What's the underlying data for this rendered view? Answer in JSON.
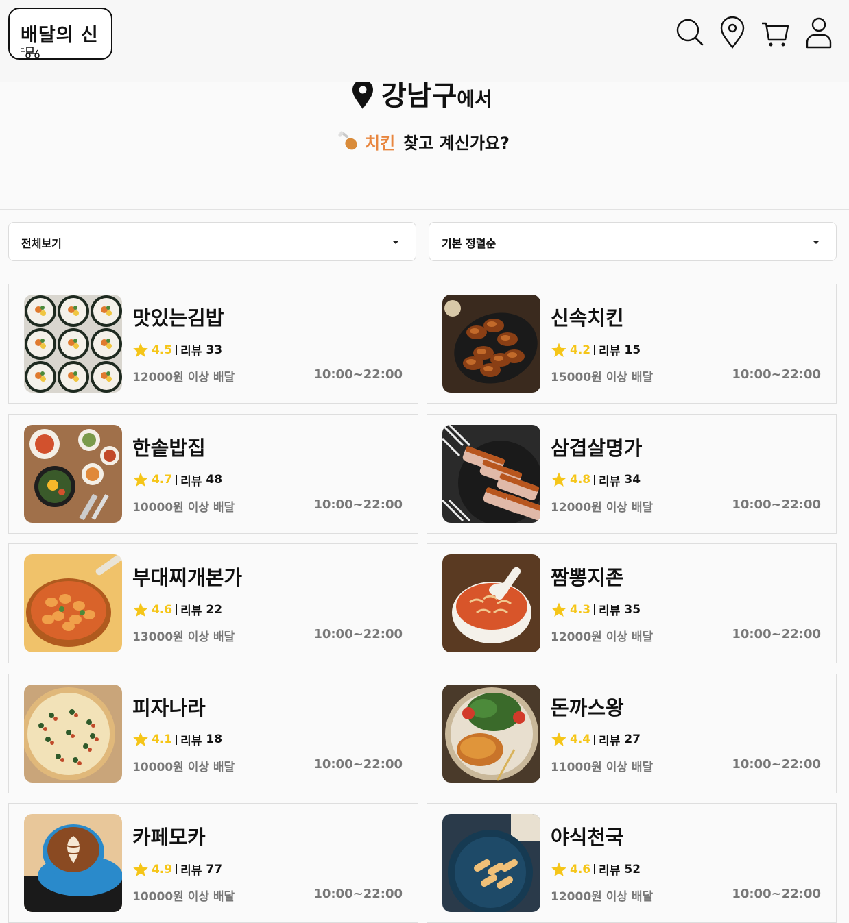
{
  "header": {
    "logo_text": "배달의 신",
    "icons": [
      "search-icon",
      "location-pin-icon",
      "cart-icon",
      "user-icon"
    ]
  },
  "hero": {
    "district": "강남구",
    "district_suffix": "에서",
    "food_word": "치킨",
    "question": "찾고 계신가요?"
  },
  "filters": {
    "category_selected": "전체보기",
    "sort_selected": "기본 정렬순"
  },
  "colors": {
    "accent_orange": "#e8863f",
    "star_yellow": "#f5c518",
    "muted_text": "#777777"
  },
  "restaurants": [
    {
      "name": "맛있는김밥",
      "score": "4.5",
      "review_label": "리뷰",
      "reviews": "33",
      "min_order": "12000원 이상 배달",
      "hours": "10:00~22:00",
      "image": "gimbap"
    },
    {
      "name": "신속치킨",
      "score": "4.2",
      "review_label": "리뷰",
      "reviews": "15",
      "min_order": "15000원 이상 배달",
      "hours": "10:00~22:00",
      "image": "chicken"
    },
    {
      "name": "한솥밥집",
      "score": "4.7",
      "review_label": "리뷰",
      "reviews": "48",
      "min_order": "10000원 이상 배달",
      "hours": "10:00~22:00",
      "image": "bibimbap"
    },
    {
      "name": "삼겹살명가",
      "score": "4.8",
      "review_label": "리뷰",
      "reviews": "34",
      "min_order": "12000원 이상 배달",
      "hours": "10:00~22:00",
      "image": "pork-belly"
    },
    {
      "name": "부대찌개본가",
      "score": "4.6",
      "review_label": "리뷰",
      "reviews": "22",
      "min_order": "13000원 이상 배달",
      "hours": "10:00~22:00",
      "image": "stew"
    },
    {
      "name": "짬뽕지존",
      "score": "4.3",
      "review_label": "리뷰",
      "reviews": "35",
      "min_order": "12000원 이상 배달",
      "hours": "10:00~22:00",
      "image": "jjamppong"
    },
    {
      "name": "피자나라",
      "score": "4.1",
      "review_label": "리뷰",
      "reviews": "18",
      "min_order": "10000원 이상 배달",
      "hours": "10:00~22:00",
      "image": "pizza"
    },
    {
      "name": "돈까스왕",
      "score": "4.4",
      "review_label": "리뷰",
      "reviews": "27",
      "min_order": "11000원 이상 배달",
      "hours": "10:00~22:00",
      "image": "cutlet"
    },
    {
      "name": "카페모카",
      "score": "4.9",
      "review_label": "리뷰",
      "reviews": "77",
      "min_order": "10000원 이상 배달",
      "hours": "10:00~22:00",
      "image": "coffee"
    },
    {
      "name": "야식천국",
      "score": "4.6",
      "review_label": "리뷰",
      "reviews": "52",
      "min_order": "12000원 이상 배달",
      "hours": "10:00~22:00",
      "image": "tteokbokki"
    }
  ]
}
